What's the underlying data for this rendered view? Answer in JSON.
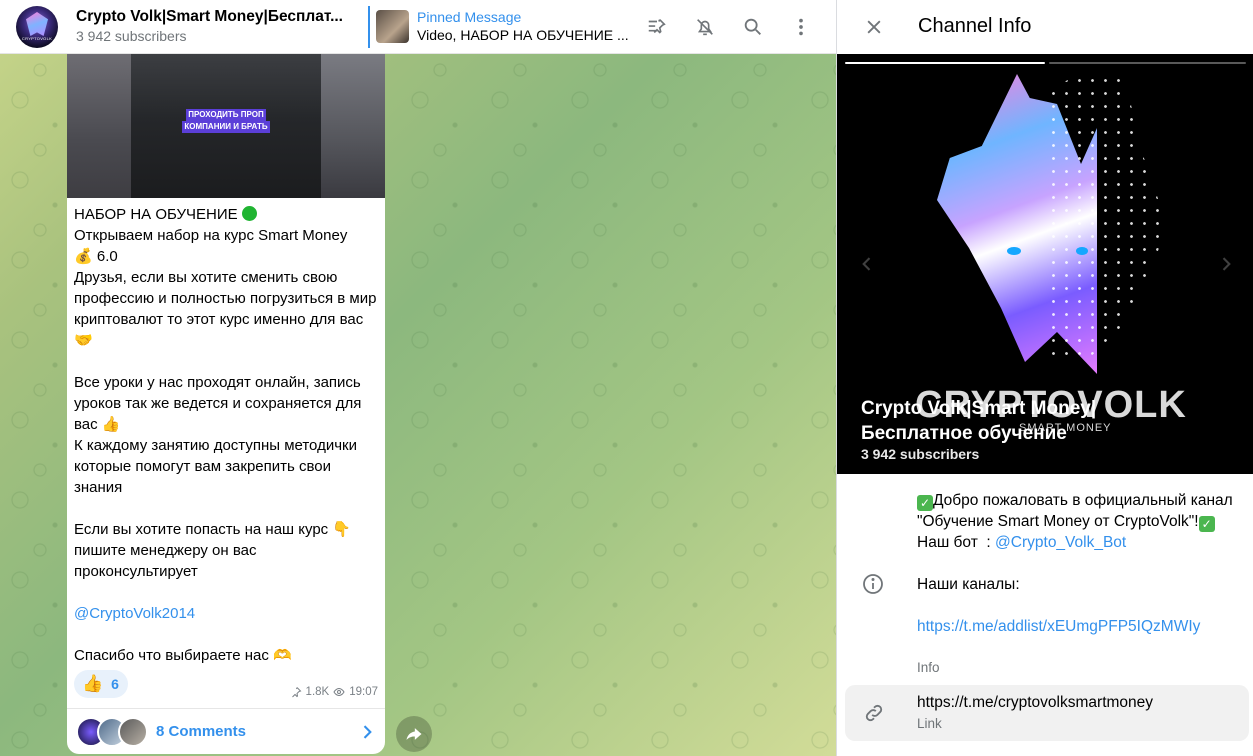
{
  "chat": {
    "title": "Crypto Volk|Smart Money|Бесплат...",
    "subscribers": "3 942 subscribers",
    "avatar_text": "CRYPTOVOLK",
    "pinned": {
      "label": "Pinned Message",
      "text": "Video, НАБОР НА ОБУЧЕНИЕ ..."
    },
    "header_icons": [
      "pinned-list-icon",
      "mute-icon",
      "search-icon",
      "more-icon"
    ]
  },
  "message": {
    "media_caption_line1": "ПРОХОДИТЬ ПРОП",
    "media_caption_line2": "КОМПАНИИ И БРАТЬ",
    "heading": "НАБОР НА ОБУЧЕНИЕ",
    "body_1": "Открываем набор на курс Smart Money",
    "body_2": "6.0",
    "body_3": "Друзья, если вы хотите сменить свою профессию и полностью погрузиться в мир криптовалют то этот курс именно для вас",
    "body_4": "Все уроки у нас проходят онлайн, запись уроков так же ведется и сохраняется для вас",
    "body_5": "К каждому занятию доступны методички которые помогут вам закрепить свои знания",
    "body_6": "Если вы хотите попасть на наш курс",
    "body_7": "пишите менеджеру он вас проконсультирует",
    "mention": "@CryptoVolk2014",
    "thanks": "Спасибо что выбираете нас",
    "reaction_count": "6",
    "views": "1.8K",
    "time": "19:07",
    "comments_label": "8 Comments"
  },
  "info": {
    "title": "Channel Info",
    "cover_brand": "CRYPTOVOLK",
    "cover_brand_sub": "SMART MONEY",
    "channel_name_line1": "Crypto Volk|Smart Money|",
    "channel_name_line2": "Бесплатное обучение",
    "subscribers": "3 942 subscribers",
    "about_line1": "Добро пожаловать в официальный канал \"Обучение Smart Money от CryptoVolk\"!",
    "about_bot_prefix": "Наш бот  : ",
    "about_bot": "@Crypto_Volk_Bot",
    "about_channels": "Наши каналы:",
    "about_link": "https://t.me/addlist/xEUmgPFP5IQzMWIy",
    "about_caption": "Info",
    "link_value": "https://t.me/cryptovolksmartmoney",
    "link_caption": "Link"
  },
  "colors": {
    "accent": "#3390ec",
    "secondary_text": "#707579",
    "check_green": "#4bb64f"
  }
}
